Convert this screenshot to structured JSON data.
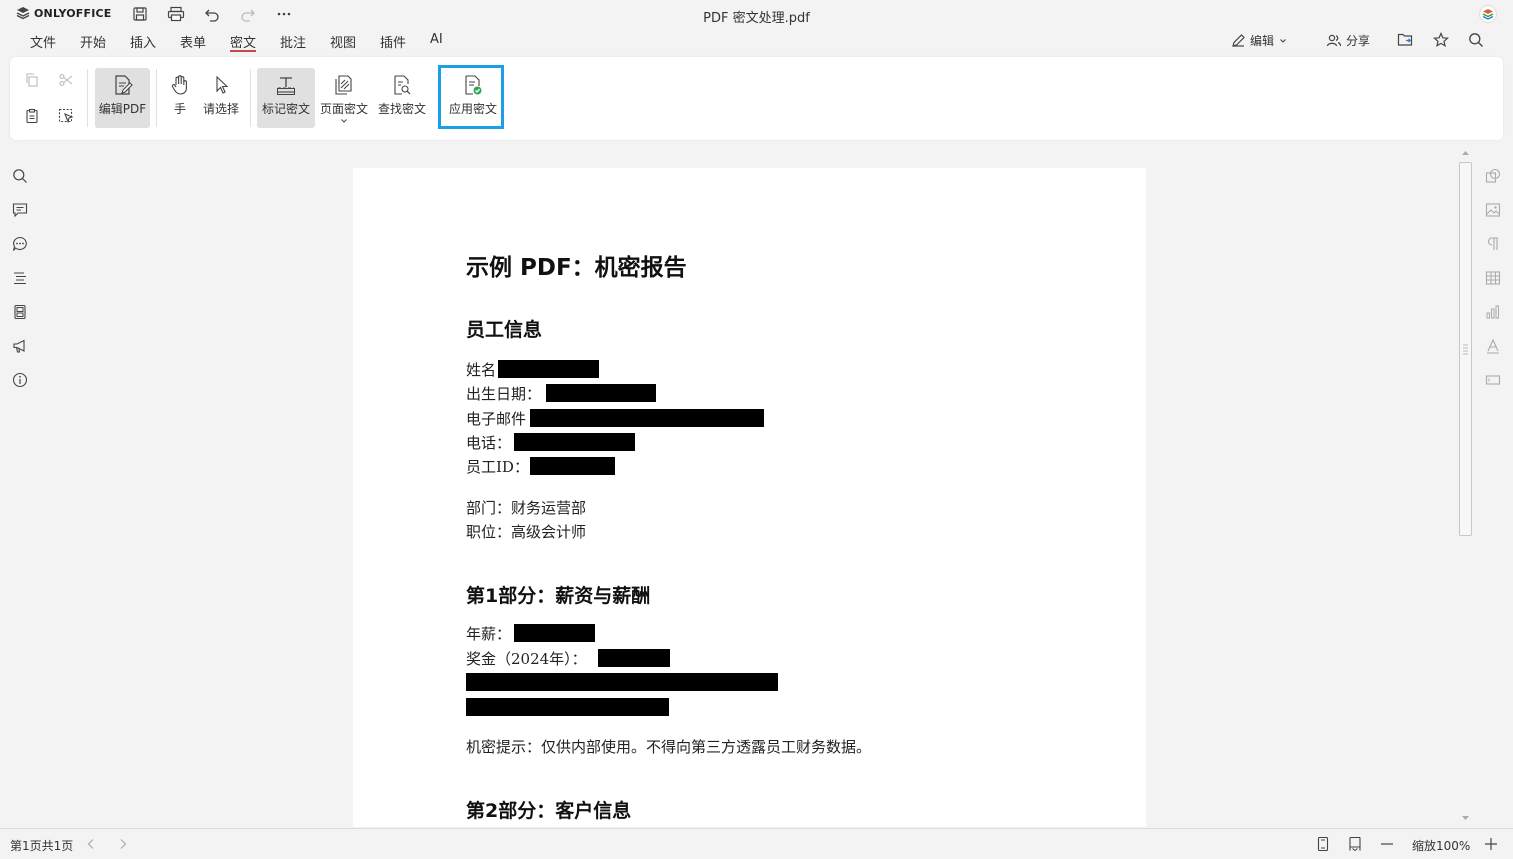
{
  "app": {
    "logo_text": "ONLYOFFICE",
    "doc_title": "PDF 密文处理.pdf"
  },
  "menu": {
    "tabs": [
      "文件",
      "开始",
      "插入",
      "表单",
      "密文",
      "批注",
      "视图",
      "插件",
      "AI"
    ],
    "active_tab": "密文",
    "edit_label": "编辑",
    "share_label": "分享"
  },
  "toolbar": {
    "edit_pdf": "编辑PDF",
    "hand": "手",
    "select": "请选择",
    "mark_redaction": "标记密文",
    "page_redaction": "页面密文",
    "find_redaction": "查找密文",
    "apply_redaction": "应用密文"
  },
  "document": {
    "title": "示例 PDF：机密报告",
    "section_employee": "员工信息",
    "name_label": "姓名",
    "dob_label": "出生日期：",
    "email_label": "电子邮件",
    "phone_label": "电话：",
    "emp_id_label": "员工ID：",
    "department": "部门：财务运营部",
    "position": "职位：高级会计师",
    "section1": "第1部分：薪资与薪酬",
    "salary_label": "年薪：",
    "bonus_label": "奖金（2024年）：",
    "notice": "机密提示：仅供内部使用。不得向第三方透露员工财务数据。",
    "section2": "第2部分：客户信息"
  },
  "status": {
    "page_info": "第1页共1页",
    "zoom": "缩放100%"
  },
  "colors": {
    "accent_red": "#c4484f",
    "highlight_blue": "#1aa0e8",
    "redaction": "#000000"
  }
}
